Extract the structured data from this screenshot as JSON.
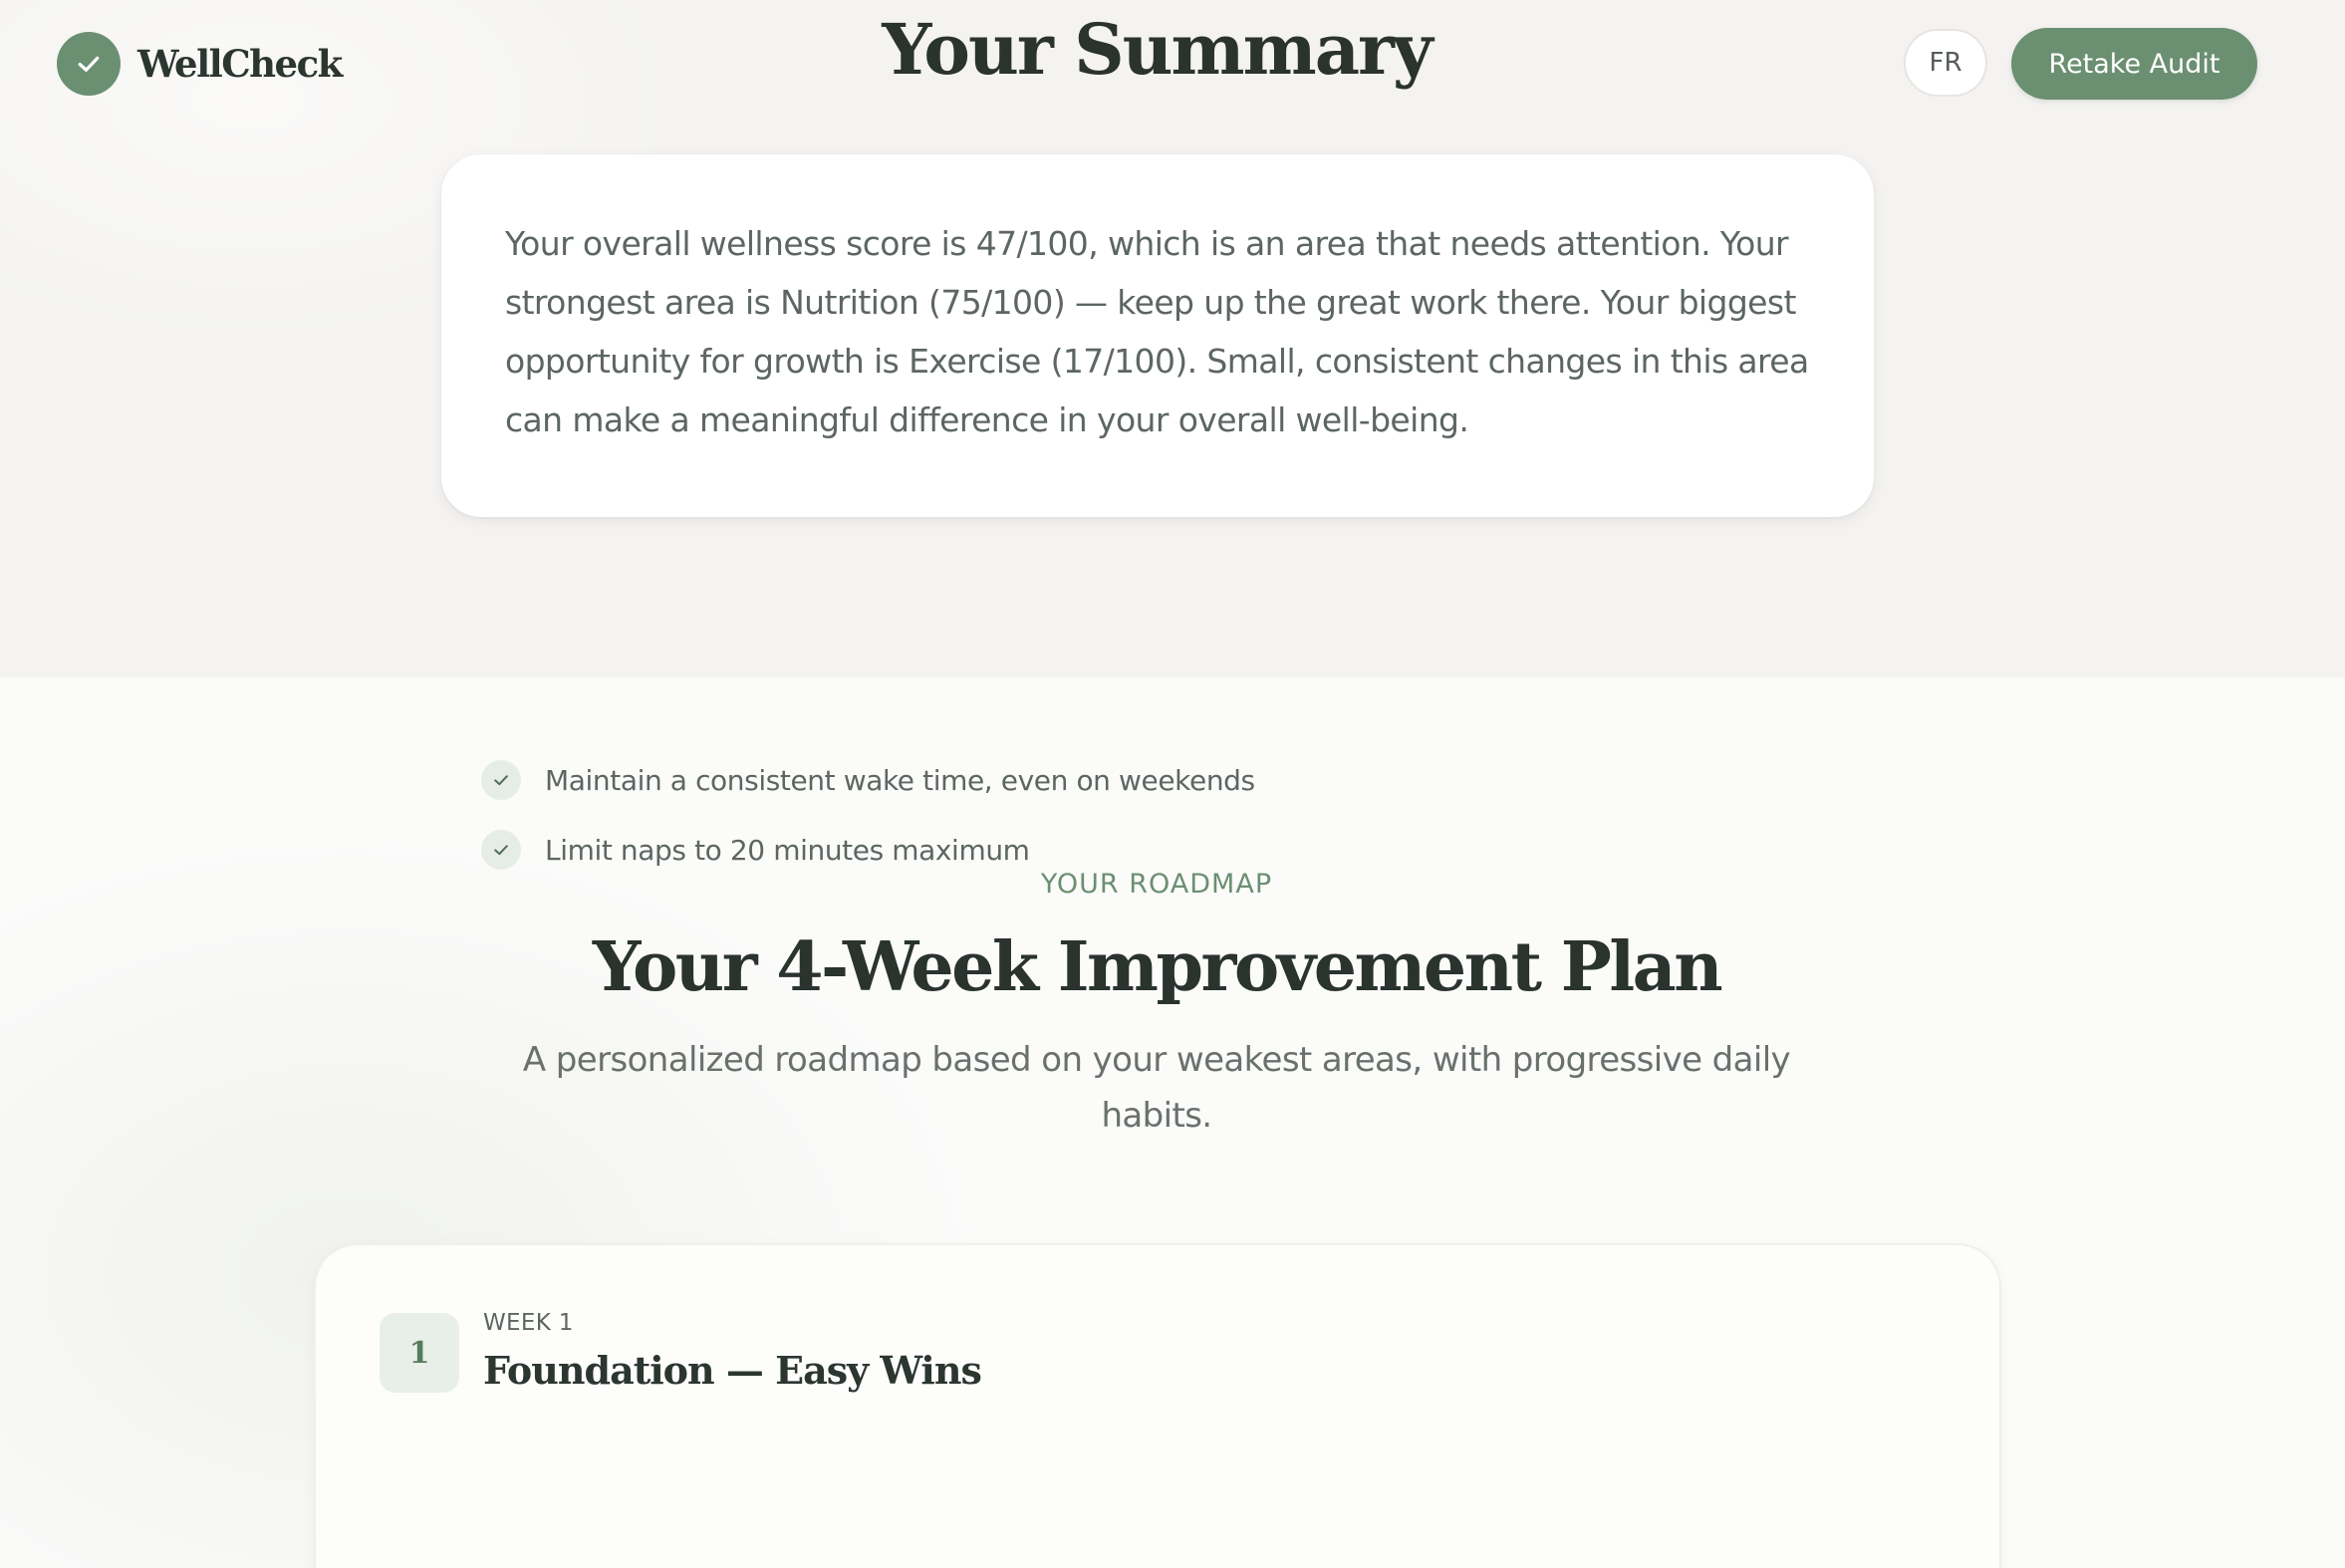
{
  "header": {
    "brand_name": "WellCheck",
    "page_title": "Your Summary",
    "lang_label": "FR",
    "retake_label": "Retake Audit"
  },
  "summary": {
    "text": "Your overall wellness score is 47/100, which is an area that needs attention. Your strongest area is Nutrition (75/100) — keep up the great work there. Your biggest opportunity for growth is Exercise (17/100). Small, consistent changes in this area can make a meaningful difference in your overall well-being."
  },
  "roadmap": {
    "eyebrow": "YOUR ROADMAP",
    "title": "Your 4-Week Improvement Plan",
    "subtitle": "A personalized roadmap based on your weakest areas, with progressive daily habits.",
    "weeks": [
      {
        "number": "1",
        "label": "WEEK 1",
        "title": "Foundation — Easy Wins",
        "habits": [
          "Maintain a consistent wake time, even on weekends",
          "Limit naps to 20 minutes maximum"
        ]
      }
    ]
  },
  "colors": {
    "accent": "#6b8f71",
    "accent_light": "#e8efe8",
    "heading": "#2a332e",
    "body_text": "#5d6661",
    "top_background": "#f4f3f1",
    "page_background": "#fbfbfa"
  },
  "icons": {
    "brand": "check-icon",
    "habit": "check-icon"
  }
}
